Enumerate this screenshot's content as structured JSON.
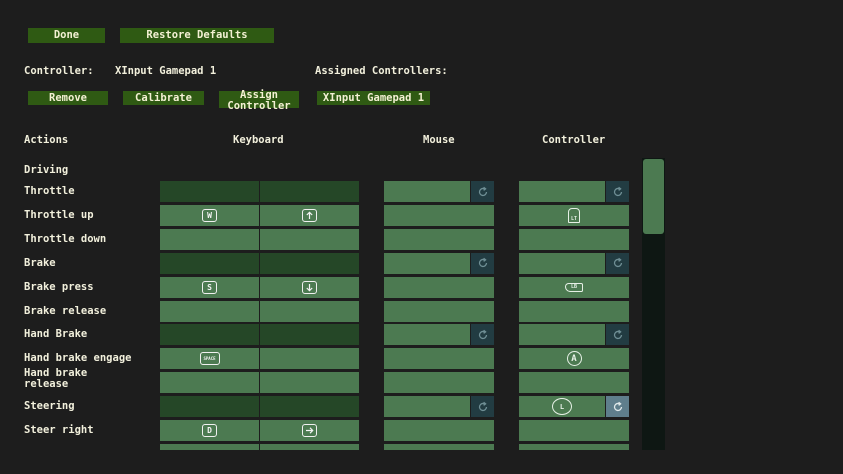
{
  "toolbar": {
    "done": "Done",
    "restore_defaults": "Restore Defaults"
  },
  "controller": {
    "label": "Controller:",
    "name": "XInput Gamepad 1",
    "assigned_label": "Assigned Controllers:",
    "assigned": [
      "XInput Gamepad 1"
    ],
    "remove": "Remove",
    "calibrate": "Calibrate",
    "assign": "Assign\nController"
  },
  "columns": {
    "actions": "Actions",
    "keyboard": "Keyboard",
    "mouse": "Mouse",
    "controller": "Controller"
  },
  "category": "Driving",
  "reset_icon": "rotate-icon",
  "colors": {
    "button": "#2f5a13",
    "cell": "#4c7a51",
    "cell_dark": "#254727",
    "reset": "#223c42"
  },
  "actions": [
    {
      "name": "Throttle",
      "type": "axis"
    },
    {
      "name": "Throttle up",
      "type": "button",
      "kb1": "W",
      "kb2": "arrow-up",
      "ctrl": "LT"
    },
    {
      "name": "Throttle down",
      "type": "button"
    },
    {
      "name": "Brake",
      "type": "axis"
    },
    {
      "name": "Brake press",
      "type": "button",
      "kb1": "S",
      "kb2": "arrow-down",
      "ctrl": "LB"
    },
    {
      "name": "Brake release",
      "type": "button"
    },
    {
      "name": "Hand Brake",
      "type": "axis"
    },
    {
      "name": "Hand brake engage",
      "type": "button",
      "kb1": "SPACE",
      "ctrl": "A"
    },
    {
      "name": "Hand brake\nrelease",
      "type": "button"
    },
    {
      "name": "Steering",
      "type": "axis",
      "ctrl": "L",
      "ctrl_reset_active": true
    },
    {
      "name": "Steer right",
      "type": "button",
      "kb1": "D",
      "kb2": "arrow-right"
    }
  ]
}
